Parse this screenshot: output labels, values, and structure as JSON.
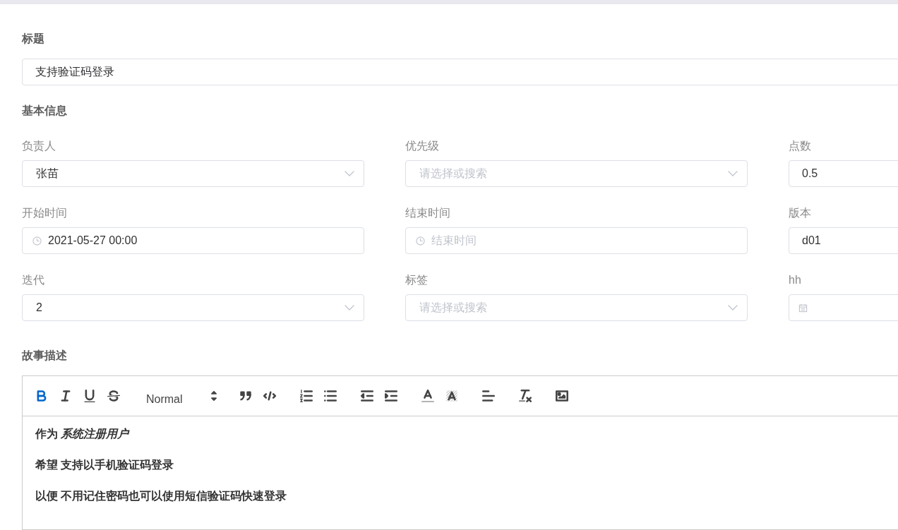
{
  "title_field": {
    "label": "标题",
    "value": "支持验证码登录"
  },
  "basic_info": {
    "heading": "基本信息",
    "fields": [
      {
        "label": "负责人",
        "kind": "select",
        "value": "张苗"
      },
      {
        "label": "优先级",
        "kind": "select",
        "placeholder": "请选择或搜索"
      },
      {
        "label": "点数",
        "kind": "text",
        "value": "0.5"
      },
      {
        "label": "开始时间",
        "kind": "time",
        "value": "2021-05-27 00:00"
      },
      {
        "label": "结束时间",
        "kind": "time",
        "placeholder": "结束时间"
      },
      {
        "label": "版本",
        "kind": "text",
        "value": "d01"
      },
      {
        "label": "迭代",
        "kind": "select",
        "value": "2"
      },
      {
        "label": "标签",
        "kind": "select",
        "placeholder": "请选择或搜索"
      },
      {
        "label": "hh",
        "kind": "date"
      }
    ]
  },
  "description": {
    "label": "故事描述",
    "toolbar_groups": [
      {
        "items": [
          {
            "kind": "bold",
            "active": true
          },
          {
            "kind": "italic",
            "active": false
          },
          {
            "kind": "underline",
            "active": false
          },
          {
            "kind": "strike",
            "active": false
          }
        ]
      },
      {
        "items": [
          {
            "kind": "header",
            "value": "Normal"
          }
        ]
      },
      {
        "items": [
          {
            "kind": "blockquote",
            "active": false
          },
          {
            "kind": "code-block",
            "active": false
          }
        ]
      },
      {
        "items": [
          {
            "kind": "ordered-list",
            "active": false
          },
          {
            "kind": "bullet-list",
            "active": false
          }
        ]
      },
      {
        "items": [
          {
            "kind": "outdent",
            "active": false
          },
          {
            "kind": "indent",
            "active": false
          }
        ]
      },
      {
        "items": [
          {
            "kind": "color",
            "active": false
          },
          {
            "kind": "background",
            "active": false
          }
        ]
      },
      {
        "items": [
          {
            "kind": "align",
            "active": false
          }
        ]
      },
      {
        "items": [
          {
            "kind": "clean",
            "active": false
          }
        ]
      },
      {
        "items": [
          {
            "kind": "image",
            "active": false
          }
        ]
      }
    ],
    "paragraphs": [
      "作为 *系统注册用户*",
      "希望 支持以手机验证码登录",
      "以便 不用记住密码也可以使用短信验证码快速登录"
    ]
  }
}
